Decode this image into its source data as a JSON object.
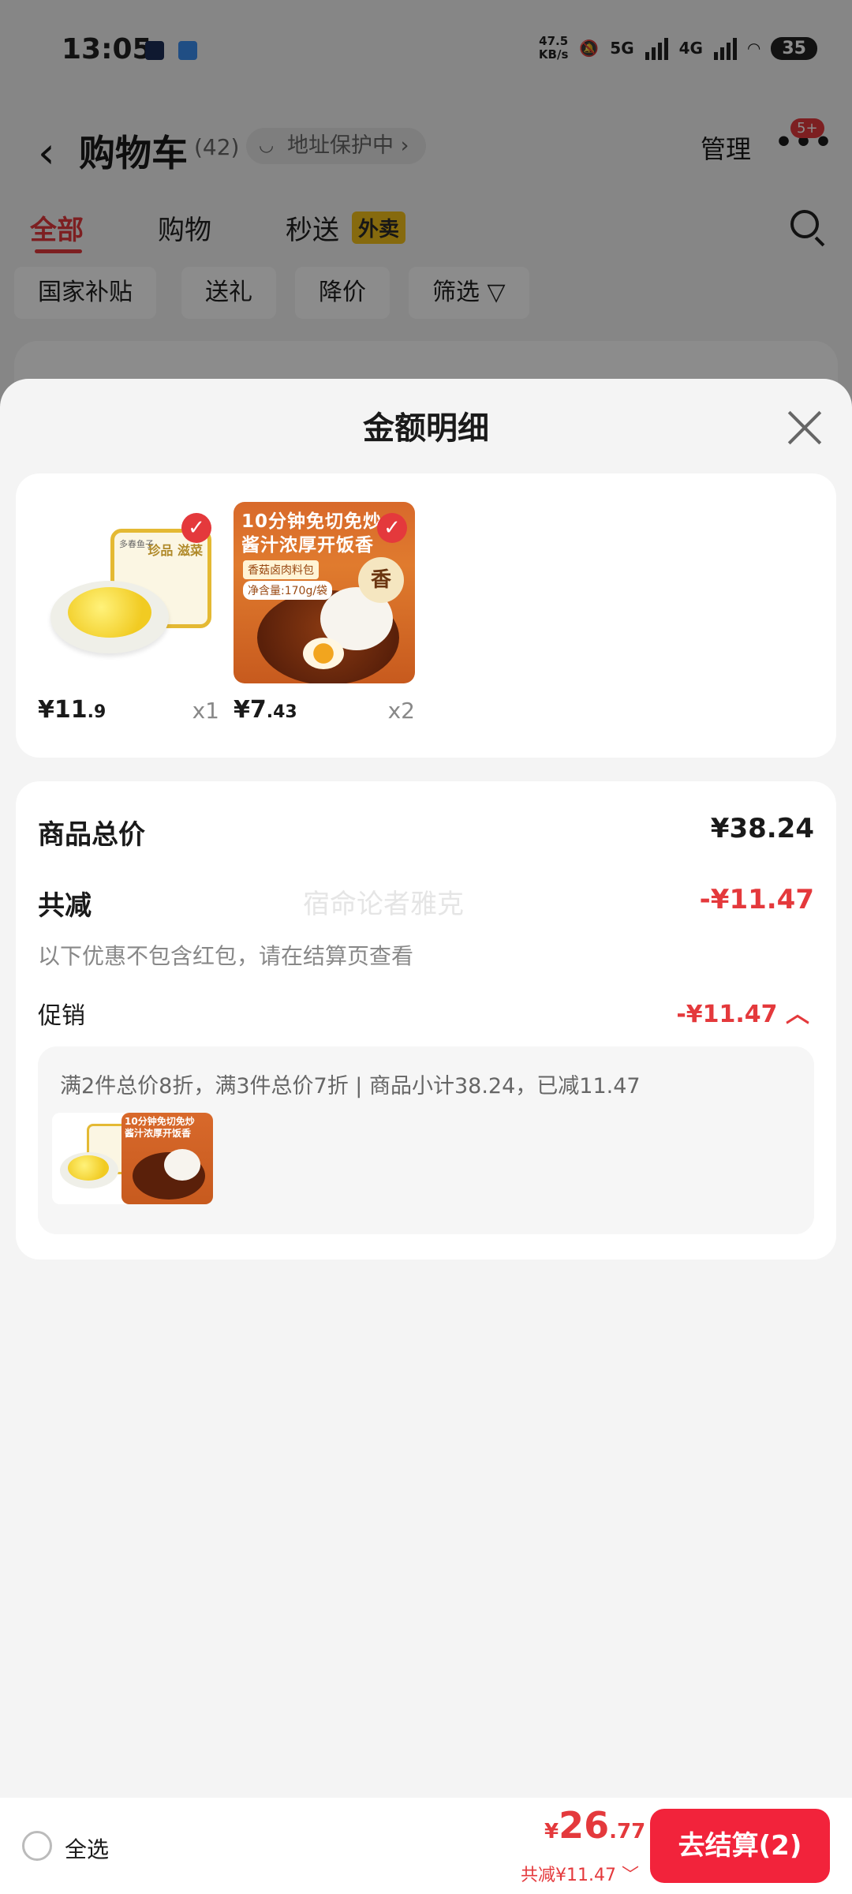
{
  "status_bar": {
    "time": "13:05",
    "net_speed_value": "47.5",
    "net_speed_unit": "KB/s",
    "signal_1": "5G",
    "signal_2": "4G",
    "battery": "35"
  },
  "nav": {
    "title": "购物车",
    "count": "(42)",
    "address_chip": "地址保护中",
    "manage": "管理",
    "more_badge": "5+"
  },
  "tabs": [
    {
      "label": "全部"
    },
    {
      "label": "购物"
    },
    {
      "label": "秒送"
    }
  ],
  "waimai_badge": "外卖",
  "filters": [
    {
      "label": "国家补贴"
    },
    {
      "label": "送礼"
    },
    {
      "label": "降价"
    },
    {
      "label": "筛选 ▽"
    }
  ],
  "sheet": {
    "title": "金额明细",
    "products": [
      {
        "price_yen": "¥11",
        "price_cents": ".9",
        "qty": "x1",
        "tray_label": "多春鱼子",
        "tray_brand": "珍品\n滋菜"
      },
      {
        "price_yen": "¥7",
        "price_cents": ".43",
        "qty": "x2",
        "headline": "10分钟免切免炒\n酱汁浓厚开饭香",
        "sub": "香菇卤肉料包",
        "net": "净含量:170g/袋",
        "seal": "香"
      }
    ],
    "total_label": "商品总价",
    "total_value": "¥38.24",
    "discount_label": "共减",
    "discount_value": "-¥11.47",
    "discount_note": "以下优惠不包含红包，请在结算页查看",
    "watermark": "宿命论者雅克",
    "promo_label": "促销",
    "promo_value": "-¥11.47 ︿",
    "promo_text": "满2件总价8折，满3件总价7折 | 商品小计38.24，已减11.47",
    "thumb_headline": "10分钟免切免炒\n酱汁浓厚开饭香"
  },
  "bottom_bar": {
    "select_all": "全选",
    "total_yen": "¥",
    "total_int": "26",
    "total_dec": ".77",
    "saving": "共减¥11.47 ﹀",
    "checkout": "去结算(2)"
  },
  "colors": {
    "accent_red": "#e4393c",
    "checkout_red": "#f2233b",
    "waimai_yellow": "#f5c21b"
  }
}
